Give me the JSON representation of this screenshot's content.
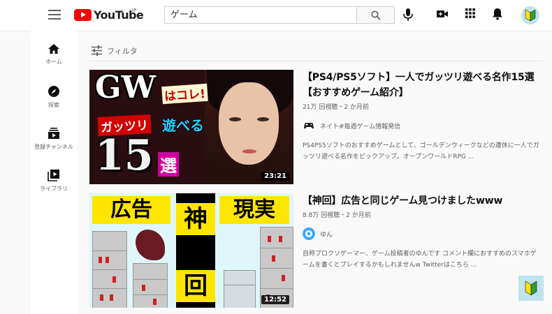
{
  "header": {
    "logo_text": "YouTube",
    "logo_region": "JP",
    "search": {
      "value": "ゲーム"
    },
    "icons": [
      "menu-icon",
      "search-icon",
      "mic-icon",
      "create-video-icon",
      "apps-grid-icon",
      "bell-icon",
      "avatar-beginner-mark-icon"
    ]
  },
  "sidebar": {
    "items": [
      {
        "label": "ホーム",
        "icon": "home-icon"
      },
      {
        "label": "探索",
        "icon": "compass-icon"
      },
      {
        "label": "登録チャンネル",
        "icon": "subscriptions-icon"
      },
      {
        "label": "ライブラリ",
        "icon": "library-icon"
      }
    ]
  },
  "filter": {
    "label": "フィルタ",
    "icon": "filter-sliders-icon"
  },
  "results": [
    {
      "title": "【PS4/PS5ソフト】一人でガッツリ遊べる名作15選【おすすめゲーム紹介】",
      "meta": "21万 回視聴・2 か月前",
      "channel": "ネイト#毎週ゲーム情報発信",
      "description": "PS4PS5ソフトのおすすめゲームとして、ゴールデンウィークなどの連休に一人でガッツリ遊べる名作をピックアップ。オープンワールドRPG ...",
      "duration": "23:21",
      "thumbnail_text": {
        "gw": "GW",
        "hakore": "はコレ!",
        "gattsuri": "ガッツリ",
        "asoberu": "遊べる",
        "number": "15",
        "sen": "選"
      }
    },
    {
      "title": "【神回】広告と同じゲーム見つけましたwww",
      "meta": "8.8万 回視聴・2 か月前",
      "channel": "ゆん",
      "description": "自称プロクソゲーマー、ゲーム投稿者のゆんです コメント欄におすすめのスマホゲームを書くとプレイするかもしれませんw Twitterはこちら ...",
      "duration": "12:52",
      "thumbnail_text": {
        "left": "広告",
        "kami": "神",
        "right": "現実",
        "kai": "回"
      }
    }
  ],
  "colors": {
    "brand_red": "#ff0000",
    "background": "#f9f9f9",
    "badge_bg": "#bfe3ef",
    "beginner_green": "#2f9e3a",
    "beginner_yellow": "#ffe100"
  }
}
